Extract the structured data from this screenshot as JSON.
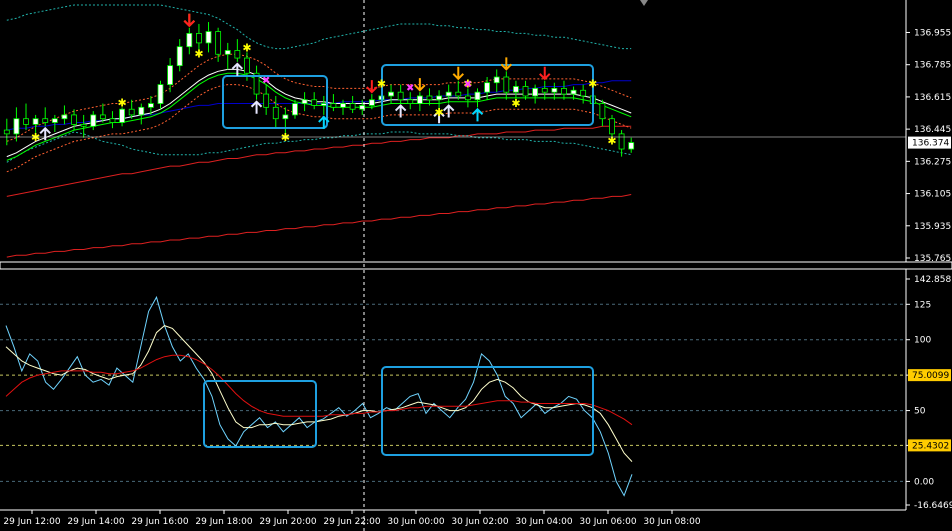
{
  "colors": {
    "background": "#000000",
    "bull_candle": "#ffffff",
    "bear_candle": "#000000",
    "wick": "#00ff00",
    "grid": "#4a6a7a",
    "bb_line": "#20b2aa",
    "ma_fast": "#ffffff",
    "ma_mid": "#00ff00",
    "ma_slow": "#0000cc",
    "ma_long": "#dd2020",
    "envelope": "#ff6030",
    "box": "#1ea0e0",
    "price_tag": "#ffffff",
    "level_tag": "#ffcc00",
    "osc_cci": "#6fd4ff",
    "osc_signal": "#ffffcc",
    "osc_ma": "#e01010"
  },
  "chart_data": [
    {
      "type": "candlestick",
      "title": "",
      "ylim": [
        135.765,
        137.1
      ],
      "price_ticks": [
        "136.955",
        "136.785",
        "136.615",
        "136.445",
        "136.275",
        "136.105",
        "135.935",
        "135.765"
      ],
      "current_price": "136.374",
      "x": [
        "29 Jun 12:00",
        "29 Jun 14:00",
        "29 Jun 16:00",
        "29 Jun 18:00",
        "29 Jun 20:00",
        "29 Jun 22:00",
        "30 Jun 00:00",
        "30 Jun 02:00",
        "30 Jun 04:00",
        "30 Jun 06:00",
        "30 Jun 08:00"
      ],
      "ohlc": [
        [
          136.44,
          136.5,
          136.36,
          136.42
        ],
        [
          136.42,
          136.56,
          136.38,
          136.5
        ],
        [
          136.5,
          136.58,
          136.44,
          136.47
        ],
        [
          136.47,
          136.52,
          136.42,
          136.5
        ],
        [
          136.5,
          136.56,
          136.46,
          136.48
        ],
        [
          136.48,
          136.52,
          136.43,
          136.5
        ],
        [
          136.5,
          136.57,
          136.47,
          136.52
        ],
        [
          136.52,
          136.55,
          136.44,
          136.47
        ],
        [
          136.47,
          136.52,
          136.4,
          136.46
        ],
        [
          136.46,
          136.54,
          136.44,
          136.52
        ],
        [
          136.52,
          136.58,
          136.48,
          136.5
        ],
        [
          136.5,
          136.54,
          136.45,
          136.48
        ],
        [
          136.48,
          136.56,
          136.46,
          136.55
        ],
        [
          136.55,
          136.6,
          136.5,
          136.52
        ],
        [
          136.52,
          136.58,
          136.47,
          136.56
        ],
        [
          136.56,
          136.62,
          136.52,
          136.58
        ],
        [
          136.58,
          136.7,
          136.55,
          136.68
        ],
        [
          136.68,
          136.82,
          136.64,
          136.78
        ],
        [
          136.78,
          136.92,
          136.75,
          136.88
        ],
        [
          136.88,
          136.98,
          136.84,
          136.95
        ],
        [
          136.95,
          137.0,
          136.86,
          136.9
        ],
        [
          136.9,
          137.01,
          136.85,
          136.96
        ],
        [
          136.96,
          136.98,
          136.8,
          136.84
        ],
        [
          136.84,
          136.9,
          136.76,
          136.86
        ],
        [
          136.86,
          136.92,
          136.8,
          136.82
        ],
        [
          136.82,
          136.85,
          136.7,
          136.74
        ],
        [
          136.74,
          136.78,
          136.6,
          136.63
        ],
        [
          136.63,
          136.68,
          136.52,
          136.56
        ],
        [
          136.56,
          136.62,
          136.45,
          136.5
        ],
        [
          136.5,
          136.56,
          136.42,
          136.52
        ],
        [
          136.52,
          136.6,
          136.5,
          136.58
        ],
        [
          136.58,
          136.64,
          136.54,
          136.6
        ],
        [
          136.6,
          136.64,
          136.55,
          136.57
        ],
        [
          136.57,
          136.62,
          136.52,
          136.58
        ],
        [
          136.58,
          136.63,
          136.54,
          136.56
        ],
        [
          136.56,
          136.6,
          136.52,
          136.58
        ],
        [
          136.58,
          136.62,
          136.53,
          136.55
        ],
        [
          136.55,
          136.6,
          136.52,
          136.57
        ],
        [
          136.57,
          136.63,
          136.55,
          136.6
        ],
        [
          136.6,
          136.66,
          136.56,
          136.62
        ],
        [
          136.62,
          136.68,
          136.58,
          136.64
        ],
        [
          136.64,
          136.68,
          136.58,
          136.6
        ],
        [
          136.6,
          136.64,
          136.55,
          136.58
        ],
        [
          136.58,
          136.64,
          136.54,
          136.62
        ],
        [
          136.62,
          136.66,
          136.57,
          136.6
        ],
        [
          136.6,
          136.65,
          136.55,
          136.62
        ],
        [
          136.62,
          136.68,
          136.58,
          136.64
        ],
        [
          136.64,
          136.7,
          136.6,
          136.62
        ],
        [
          136.62,
          136.66,
          136.56,
          136.6
        ],
        [
          136.6,
          136.66,
          136.56,
          136.64
        ],
        [
          136.64,
          136.72,
          136.6,
          136.69
        ],
        [
          136.69,
          136.76,
          136.64,
          136.72
        ],
        [
          136.72,
          136.75,
          136.6,
          136.64
        ],
        [
          136.64,
          136.7,
          136.6,
          136.67
        ],
        [
          136.67,
          136.7,
          136.6,
          136.62
        ],
        [
          136.62,
          136.68,
          136.58,
          136.66
        ],
        [
          136.66,
          136.7,
          136.6,
          136.64
        ],
        [
          136.64,
          136.69,
          136.6,
          136.66
        ],
        [
          136.66,
          136.7,
          136.6,
          136.63
        ],
        [
          136.63,
          136.67,
          136.6,
          136.65
        ],
        [
          136.65,
          136.68,
          136.58,
          136.62
        ],
        [
          136.62,
          136.66,
          136.56,
          136.58
        ],
        [
          136.58,
          136.6,
          136.46,
          136.5
        ],
        [
          136.5,
          136.52,
          136.4,
          136.42
        ],
        [
          136.42,
          136.44,
          136.3,
          136.34
        ],
        [
          136.34,
          136.4,
          136.32,
          136.374
        ]
      ],
      "upper_band": [
        137.02,
        137.03,
        137.05,
        137.06,
        137.07,
        137.08,
        137.09,
        137.1,
        137.1,
        137.1,
        137.1,
        137.1,
        137.1,
        137.1,
        137.1,
        137.1,
        137.1,
        137.09,
        137.08,
        137.07,
        137.06,
        137.05,
        137.03,
        137.0,
        136.97,
        136.93,
        136.9,
        136.88,
        136.87,
        136.87,
        136.88,
        136.89,
        136.9,
        136.92,
        136.93,
        136.94,
        136.95,
        136.96,
        136.97,
        136.98,
        136.99,
        137.0,
        137.0,
        137.0,
        137.0,
        136.99,
        136.99,
        136.98,
        136.98,
        136.97,
        136.97,
        136.96,
        136.96,
        136.95,
        136.95,
        136.94,
        136.94,
        136.93,
        136.93,
        136.92,
        136.91,
        136.9,
        136.89,
        136.88,
        136.87,
        136.87
      ],
      "lower_band": [
        136.27,
        136.3,
        136.33,
        136.35,
        136.37,
        136.39,
        136.41,
        136.43,
        136.42,
        136.4,
        136.38,
        136.37,
        136.36,
        136.34,
        136.33,
        136.32,
        136.31,
        136.31,
        136.31,
        136.31,
        136.31,
        136.32,
        136.32,
        136.33,
        136.34,
        136.35,
        136.36,
        136.37,
        136.37,
        136.38,
        136.38,
        136.39,
        136.39,
        136.4,
        136.4,
        136.41,
        136.41,
        136.42,
        136.42,
        136.42,
        136.43,
        136.43,
        136.43,
        136.42,
        136.42,
        136.42,
        136.42,
        136.41,
        136.41,
        136.4,
        136.4,
        136.4,
        136.39,
        136.39,
        136.39,
        136.38,
        136.38,
        136.38,
        136.37,
        136.37,
        136.36,
        136.35,
        136.34,
        136.33,
        136.32,
        136.31
      ],
      "ma_fast": [
        136.3,
        136.32,
        136.35,
        136.38,
        136.4,
        136.42,
        136.44,
        136.46,
        136.47,
        136.48,
        136.49,
        136.5,
        136.5,
        136.51,
        136.52,
        136.53,
        136.55,
        136.58,
        136.62,
        136.66,
        136.7,
        136.73,
        136.75,
        136.76,
        136.76,
        136.75,
        136.73,
        136.7,
        136.66,
        136.63,
        136.61,
        136.6,
        136.59,
        136.59,
        136.58,
        136.58,
        136.58,
        136.58,
        136.58,
        136.59,
        136.6,
        136.6,
        136.6,
        136.6,
        136.6,
        136.6,
        136.61,
        136.61,
        136.61,
        136.61,
        136.62,
        136.63,
        136.63,
        136.63,
        136.63,
        136.63,
        136.63,
        136.63,
        136.63,
        136.63,
        136.62,
        136.61,
        136.59,
        136.57,
        136.55,
        136.53
      ],
      "ma_slow": [
        136.44,
        136.45,
        136.45,
        136.46,
        136.46,
        136.47,
        136.47,
        136.48,
        136.48,
        136.49,
        136.49,
        136.5,
        136.5,
        136.51,
        136.52,
        136.52,
        136.53,
        136.54,
        136.55,
        136.56,
        136.57,
        136.57,
        136.58,
        136.58,
        136.58,
        136.58,
        136.58,
        136.58,
        136.58,
        136.58,
        136.58,
        136.58,
        136.58,
        136.58,
        136.58,
        136.59,
        136.59,
        136.59,
        136.59,
        136.6,
        136.6,
        136.6,
        136.61,
        136.61,
        136.61,
        136.62,
        136.62,
        136.62,
        136.63,
        136.63,
        136.64,
        136.64,
        136.65,
        136.65,
        136.66,
        136.66,
        136.67,
        136.67,
        136.67,
        136.68,
        136.68,
        136.69,
        136.69,
        136.7,
        136.7,
        136.7
      ],
      "ma_long": [
        136.09,
        136.1,
        136.11,
        136.12,
        136.13,
        136.14,
        136.15,
        136.16,
        136.17,
        136.18,
        136.19,
        136.2,
        136.21,
        136.21,
        136.22,
        136.23,
        136.24,
        136.25,
        136.25,
        136.26,
        136.27,
        136.27,
        136.28,
        136.29,
        136.29,
        136.3,
        136.31,
        136.31,
        136.32,
        136.32,
        136.33,
        136.33,
        136.34,
        136.34,
        136.35,
        136.35,
        136.36,
        136.36,
        136.37,
        136.37,
        136.38,
        136.38,
        136.39,
        136.39,
        136.4,
        136.4,
        136.4,
        136.41,
        136.41,
        136.42,
        136.42,
        136.42,
        136.43,
        136.43,
        136.43,
        136.44,
        136.44,
        136.44,
        136.45,
        136.45,
        136.45,
        136.45,
        136.46,
        136.46,
        136.46,
        136.46
      ],
      "ma_200": [
        135.77,
        135.78,
        135.78,
        135.79,
        135.79,
        135.8,
        135.8,
        135.81,
        135.81,
        135.82,
        135.82,
        135.83,
        135.83,
        135.84,
        135.84,
        135.85,
        135.85,
        135.86,
        135.86,
        135.87,
        135.87,
        135.88,
        135.88,
        135.89,
        135.89,
        135.9,
        135.9,
        135.91,
        135.91,
        135.92,
        135.92,
        135.93,
        135.93,
        135.94,
        135.94,
        135.95,
        135.95,
        135.96,
        135.96,
        135.97,
        135.97,
        135.98,
        135.98,
        135.99,
        135.99,
        136.0,
        136.0,
        136.01,
        136.01,
        136.02,
        136.02,
        136.03,
        136.03,
        136.04,
        136.04,
        136.05,
        136.05,
        136.06,
        136.06,
        136.07,
        136.07,
        136.08,
        136.08,
        136.09,
        136.09,
        136.1
      ]
    },
    {
      "type": "line",
      "title": "",
      "ylim": [
        -16.6469,
        142.8581
      ],
      "ticks": [
        "142.8581",
        "125",
        "100",
        "75.0099",
        "50",
        "25.4302",
        "0.00",
        "-16.6469"
      ],
      "levels": [
        75.0099,
        25.4302
      ],
      "series": [
        {
          "values": [
            110,
            95,
            78,
            90,
            85,
            70,
            65,
            72,
            80,
            88,
            75,
            70,
            72,
            68,
            80,
            75,
            70,
            95,
            120,
            130,
            110,
            95,
            85,
            90,
            80,
            72,
            60,
            40,
            30,
            25,
            35,
            40,
            45,
            38,
            42,
            35,
            40,
            45,
            38,
            42,
            44,
            48,
            52,
            46,
            50,
            55,
            45,
            48,
            52,
            50,
            55,
            60,
            62,
            48,
            55,
            50,
            45,
            52,
            58,
            70,
            90,
            85,
            75,
            60,
            55,
            45,
            50,
            55,
            48,
            52,
            55,
            60,
            58,
            50,
            45,
            35,
            20,
            0,
            -10,
            5
          ]
        },
        {
          "values": [
            95,
            90,
            85,
            82,
            80,
            78,
            76,
            75,
            78,
            80,
            79,
            76,
            74,
            72,
            74,
            75,
            76,
            82,
            92,
            105,
            110,
            108,
            102,
            96,
            90,
            84,
            76,
            64,
            52,
            42,
            38,
            38,
            40,
            40,
            41,
            40,
            40,
            41,
            42,
            42,
            43,
            44,
            46,
            47,
            48,
            50,
            50,
            49,
            50,
            51,
            52,
            54,
            56,
            55,
            54,
            52,
            50,
            50,
            52,
            57,
            65,
            70,
            72,
            70,
            66,
            60,
            56,
            54,
            52,
            52,
            53,
            54,
            55,
            54,
            52,
            48,
            40,
            30,
            20,
            14
          ]
        },
        {
          "values": [
            60,
            65,
            70,
            73,
            75,
            76,
            77,
            78,
            78,
            78,
            78,
            77,
            77,
            76,
            76,
            77,
            78,
            80,
            83,
            86,
            88,
            89,
            89,
            88,
            86,
            83,
            79,
            74,
            68,
            62,
            57,
            53,
            50,
            48,
            47,
            46,
            46,
            46,
            46,
            46,
            46,
            47,
            47,
            47,
            48,
            48,
            49,
            49,
            50,
            50,
            51,
            52,
            52,
            53,
            53,
            53,
            53,
            53,
            53,
            54,
            55,
            56,
            57,
            57,
            57,
            56,
            56,
            55,
            55,
            55,
            55,
            55,
            55,
            55,
            54,
            52,
            50,
            47,
            44,
            40
          ]
        }
      ]
    }
  ]
}
